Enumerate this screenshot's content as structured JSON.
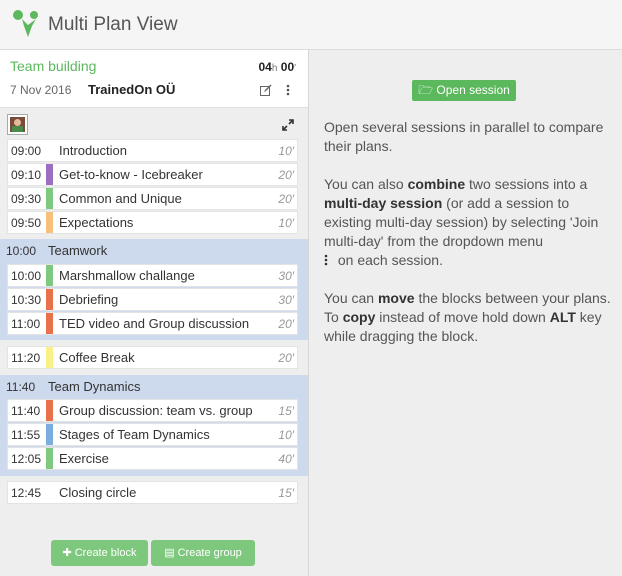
{
  "app": {
    "title": "Multi Plan View"
  },
  "session": {
    "title": "Team building",
    "duration_hours": "04",
    "duration_hours_unit": "h",
    "duration_minutes": "00",
    "duration_minutes_unit": "′",
    "date": "7 Nov 2016",
    "organization": "TrainedOn OÜ"
  },
  "blocks": [
    {
      "time": "09:00",
      "name": "Introduction",
      "duration": "10′",
      "color": "#ffffff"
    },
    {
      "time": "09:10",
      "name": "Get-to-know - Icebreaker",
      "duration": "20′",
      "color": "#9b6fbf"
    },
    {
      "time": "09:30",
      "name": "Common and Unique",
      "duration": "20′",
      "color": "#7fc87f"
    },
    {
      "time": "09:50",
      "name": "Expectations",
      "duration": "10′",
      "color": "#f7c07a"
    }
  ],
  "groups": [
    {
      "time": "10:00",
      "name": "Teamwork",
      "blocks": [
        {
          "time": "10:00",
          "name": "Marshmallow challange",
          "duration": "30′",
          "color": "#7fc87f"
        },
        {
          "time": "10:30",
          "name": "Debriefing",
          "duration": "30′",
          "color": "#e8704a"
        },
        {
          "time": "11:00",
          "name": "TED video and Group discussion",
          "duration": "20′",
          "color": "#e8704a"
        }
      ]
    },
    {
      "time": "11:40",
      "name": "Team Dynamics",
      "blocks": [
        {
          "time": "11:40",
          "name": "Group discussion: team vs. group",
          "duration": "15′",
          "color": "#e8704a"
        },
        {
          "time": "11:55",
          "name": "Stages of Team Dynamics",
          "duration": "10′",
          "color": "#7aaede"
        },
        {
          "time": "12:05",
          "name": "Exercise",
          "duration": "40′",
          "color": "#7fc87f"
        }
      ]
    }
  ],
  "break": {
    "time": "11:20",
    "name": "Coffee Break",
    "duration": "20′",
    "color": "#faf08a"
  },
  "closing": {
    "time": "12:45",
    "name": "Closing circle",
    "duration": "15′",
    "color": "#ffffff"
  },
  "buttons": {
    "create_block": "Create block",
    "create_group": "Create group",
    "open_session": "Open session"
  },
  "info": {
    "p1": "Open several sessions in parallel to compare their plans.",
    "p2_a": "You can also ",
    "p2_b": "combine",
    "p2_c": " two sessions into a ",
    "p2_d": "multi-day session",
    "p2_e": " (or add a session to existing multi-day session) by selecting 'Join multi-day' from the dropdown menu",
    "p2_f": "on each session.",
    "p3_a": "You can ",
    "p3_b": "move",
    "p3_c": " the blocks between your plans. To ",
    "p3_d": "copy",
    "p3_e": " instead of move hold down ",
    "p3_f": "ALT",
    "p3_g": " key while dragging the block."
  }
}
